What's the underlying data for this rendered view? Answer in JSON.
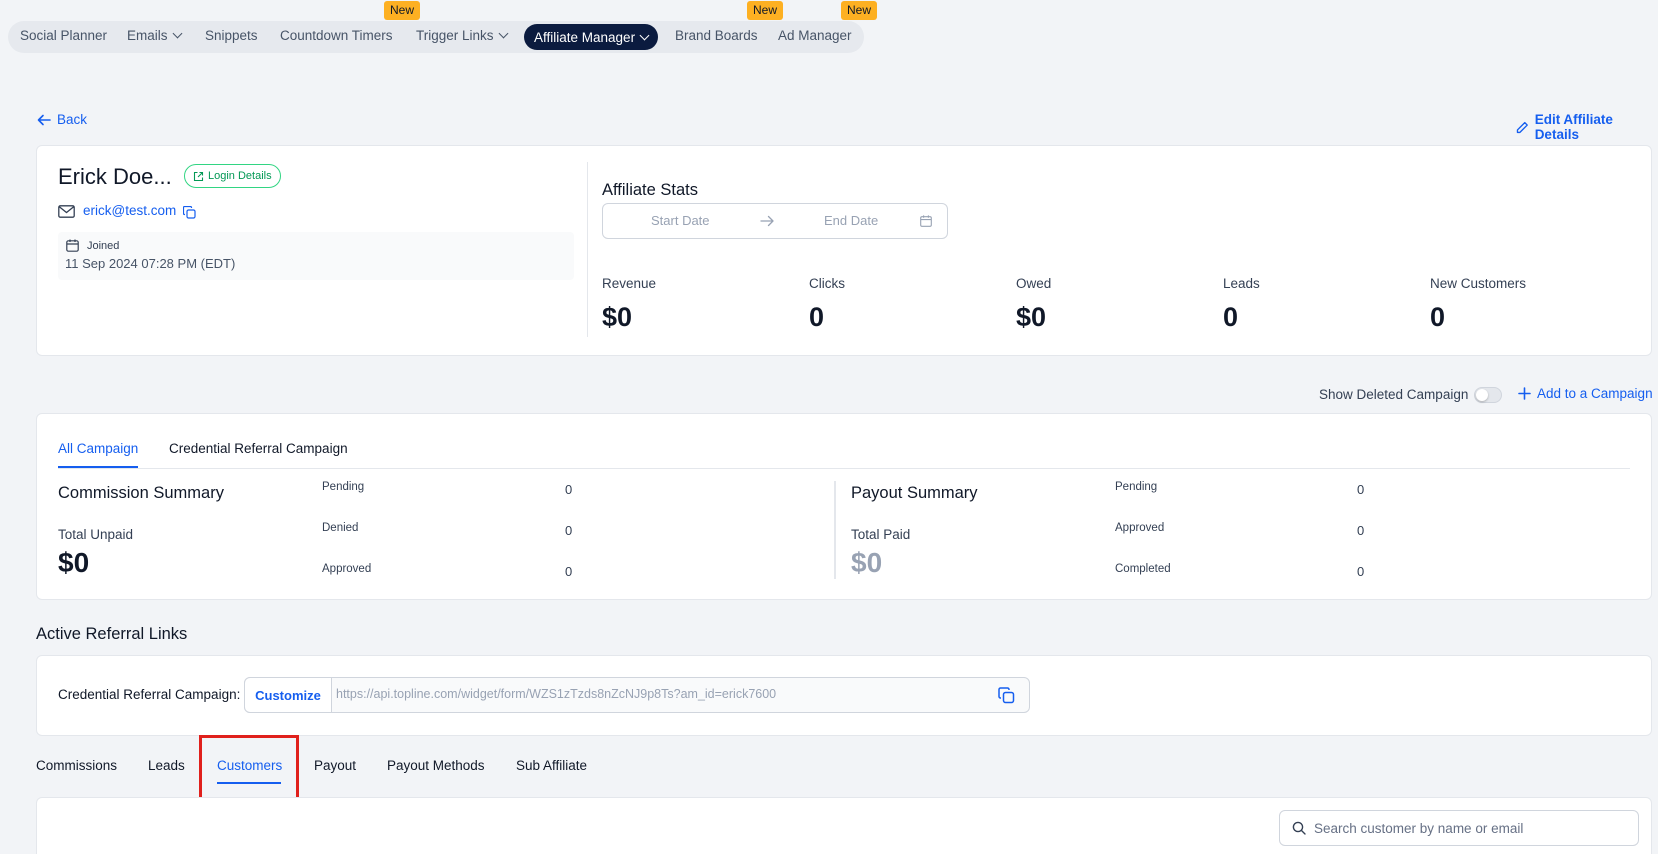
{
  "nav": {
    "items": [
      {
        "label": "Social Planner"
      },
      {
        "label": "Emails"
      },
      {
        "label": "Snippets"
      },
      {
        "label": "Countdown Timers"
      },
      {
        "label": "Trigger Links"
      },
      {
        "label": "Affiliate Manager"
      },
      {
        "label": "Brand Boards"
      },
      {
        "label": "Ad Manager"
      }
    ],
    "badge": "New"
  },
  "header": {
    "back": "Back",
    "edit": "Edit Affiliate Details"
  },
  "profile": {
    "name": "Erick Doe...",
    "login_details": "Login Details",
    "email": "erick@test.com",
    "joined_label": "Joined",
    "joined_date": "11 Sep 2024 07:28 PM (EDT)"
  },
  "stats": {
    "title": "Affiliate Stats",
    "start_placeholder": "Start Date",
    "end_placeholder": "End Date",
    "items": [
      {
        "label": "Revenue",
        "value": "$0"
      },
      {
        "label": "Clicks",
        "value": "0"
      },
      {
        "label": "Owed",
        "value": "$0"
      },
      {
        "label": "Leads",
        "value": "0"
      },
      {
        "label": "New Customers",
        "value": "0"
      }
    ]
  },
  "campaign_actions": {
    "show_deleted": "Show Deleted Campaign",
    "add": "Add to a Campaign"
  },
  "campaign_tabs": [
    "All Campaign",
    "Credential Referral Campaign"
  ],
  "commission": {
    "title": "Commission Summary",
    "total_label": "Total Unpaid",
    "total_value": "$0",
    "rows": [
      {
        "label": "Pending",
        "value": "0"
      },
      {
        "label": "Denied",
        "value": "0"
      },
      {
        "label": "Approved",
        "value": "0"
      }
    ]
  },
  "payout": {
    "title": "Payout Summary",
    "total_label": "Total Paid",
    "total_value": "$0",
    "rows": [
      {
        "label": "Pending",
        "value": "0"
      },
      {
        "label": "Approved",
        "value": "0"
      },
      {
        "label": "Completed",
        "value": "0"
      }
    ]
  },
  "referral": {
    "title": "Active Referral Links",
    "campaign_label": "Credential Referral Campaign:",
    "customize": "Customize",
    "url": "https://api.topline.com/widget/form/WZS1zTzds8nZcNJ9p8Ts?am_id=erick7600"
  },
  "bottom_tabs": [
    "Commissions",
    "Leads",
    "Customers",
    "Payout",
    "Payout Methods",
    "Sub Affiliate"
  ],
  "search": {
    "placeholder": "Search customer by name or email"
  },
  "colors": {
    "accent": "#155eef",
    "nav_active": "#0b1b3f",
    "badge": "#fdb022",
    "highlight": "#e0201c"
  }
}
